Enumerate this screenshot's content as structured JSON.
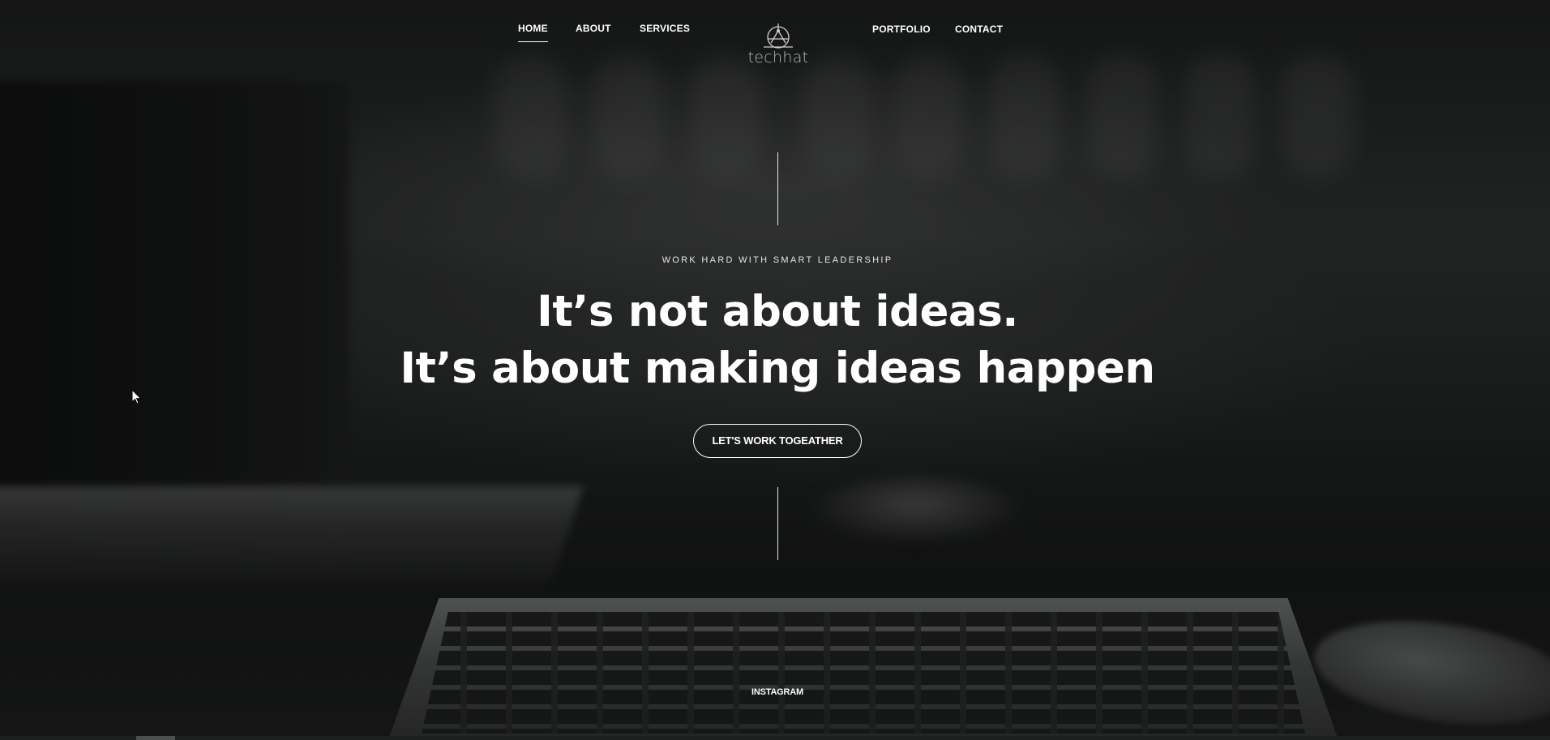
{
  "nav": {
    "home": "HOME",
    "about": "ABOUT",
    "services": "SERVICES",
    "portfolio": "PORTFOLIO",
    "contact": "CONTACT",
    "active": "HOME"
  },
  "logo": {
    "text": "techhat",
    "icon": "logo-emblem-icon",
    "color": "#b9b9b9"
  },
  "hero": {
    "tagline": "WORK HARD WITH SMART LEADERSHIP",
    "headline_line1": "It’s not about ideas.",
    "headline_line2": "It’s about making ideas happen",
    "cta_label": "LET'S WORK TOGEATHER"
  },
  "footer": {
    "instagram": "INSTAGRAM"
  },
  "colors": {
    "text": "#ffffff",
    "background": "#1e2020"
  }
}
